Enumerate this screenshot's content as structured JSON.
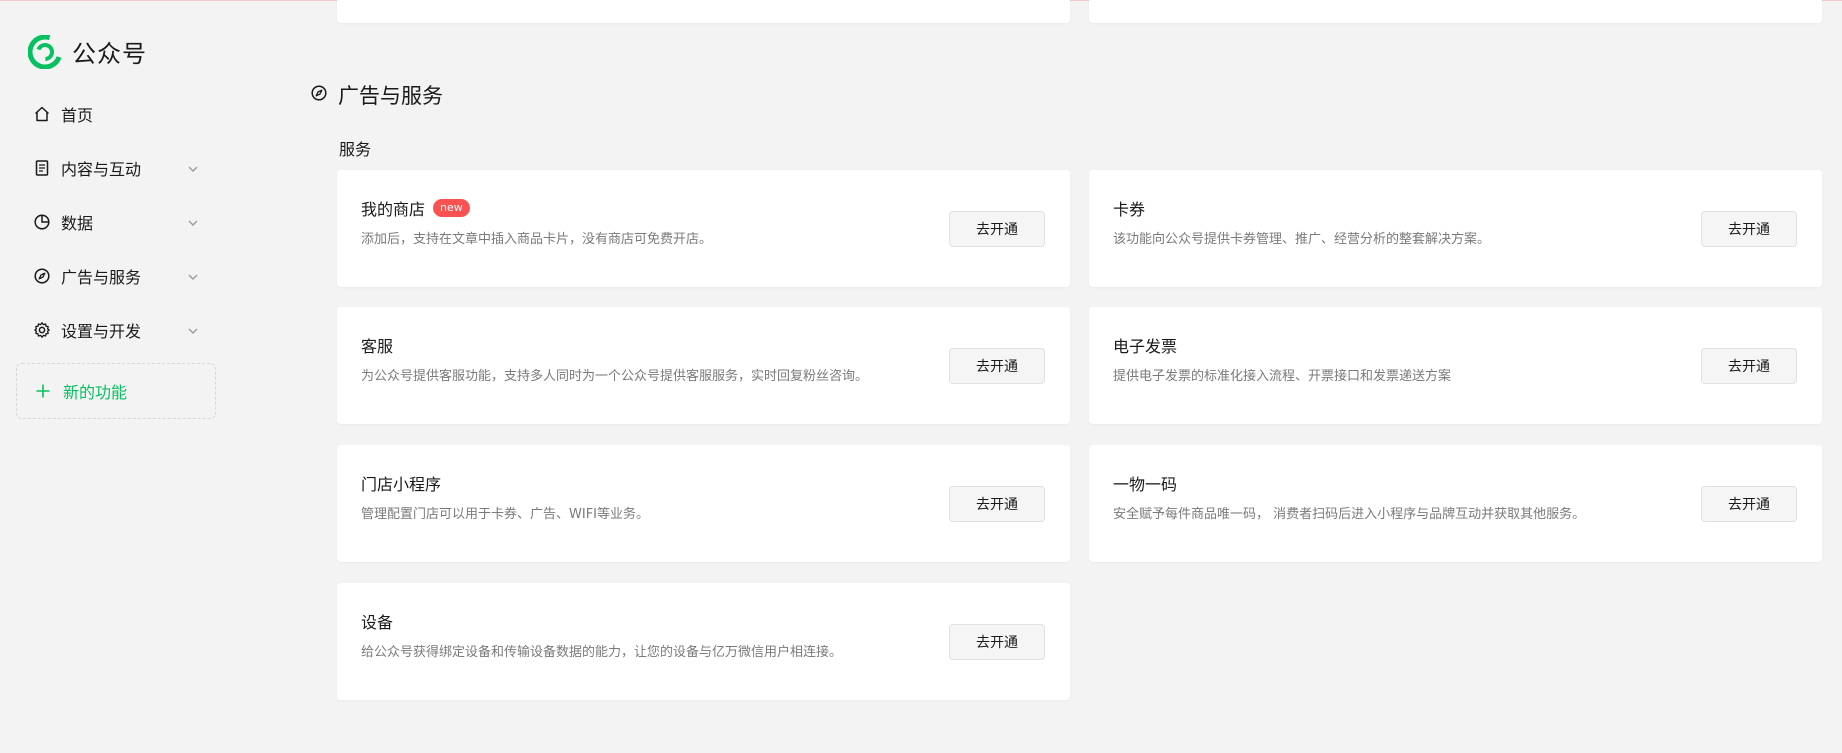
{
  "app": {
    "logo_text": "公众号",
    "brand_color": "#07c160"
  },
  "sidebar": {
    "items": [
      {
        "label": "首页",
        "icon": "home-icon",
        "expandable": false
      },
      {
        "label": "内容与互动",
        "icon": "document-icon",
        "expandable": true
      },
      {
        "label": "数据",
        "icon": "pie-chart-icon",
        "expandable": true
      },
      {
        "label": "广告与服务",
        "icon": "compass-icon",
        "expandable": true
      },
      {
        "label": "设置与开发",
        "icon": "gear-icon",
        "expandable": true
      }
    ],
    "new_feature_label": "新的功能"
  },
  "main": {
    "section_title": "广告与服务",
    "section_icon": "compass-icon",
    "subsection_title": "服务",
    "cards": [
      {
        "title": "我的商店",
        "badge": "new",
        "desc": "添加后，支持在文章中插入商品卡片，没有商店可免费开店。",
        "button": "去开通"
      },
      {
        "title": "卡券",
        "badge": "",
        "desc": "该功能向公众号提供卡券管理、推广、经营分析的整套解决方案。",
        "button": "去开通"
      },
      {
        "title": "客服",
        "badge": "",
        "desc": "为公众号提供客服功能，支持多人同时为一个公众号提供客服服务，实时回复粉丝咨询。",
        "button": "去开通"
      },
      {
        "title": "电子发票",
        "badge": "",
        "desc": "提供电子发票的标准化接入流程、开票接口和发票递送方案",
        "button": "去开通"
      },
      {
        "title": "门店小程序",
        "badge": "",
        "desc": "管理配置门店可以用于卡券、广告、WIFI等业务。",
        "button": "去开通"
      },
      {
        "title": "一物一码",
        "badge": "",
        "desc": "安全赋予每件商品唯一码， 消费者扫码后进入小程序与品牌互动并获取其他服务。",
        "button": "去开通"
      },
      {
        "title": "设备",
        "badge": "",
        "desc": "给公众号获得绑定设备和传输设备数据的能力，让您的设备与亿万微信用户相连接。",
        "button": "去开通"
      }
    ]
  },
  "colors": {
    "badge": "#fa5151",
    "background": "#f3f3f3",
    "card": "#ffffff"
  }
}
